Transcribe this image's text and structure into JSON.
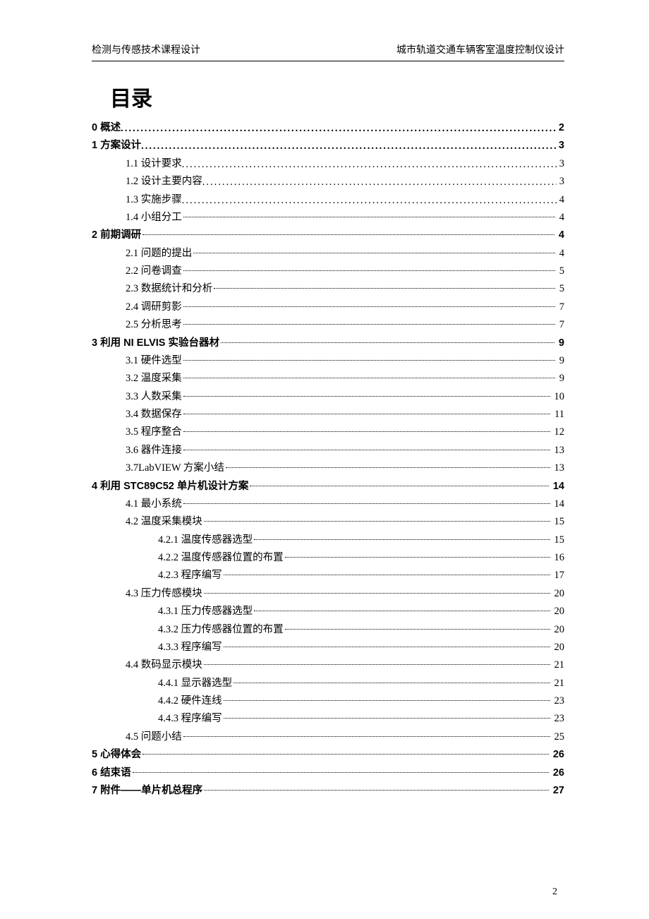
{
  "header": {
    "left": "检测与传感技术课程设计",
    "right": "城市轨道交通车辆客室温度控制仪设计"
  },
  "title": "目录",
  "page_number": "2",
  "toc": [
    {
      "level": 0,
      "label": "0 概述",
      "page": "2",
      "style": "dotted"
    },
    {
      "level": 0,
      "label": "1 方案设计",
      "page": "3",
      "style": "dotted"
    },
    {
      "level": 1,
      "label": "1.1 设计要求",
      "page": "3",
      "style": "dotted"
    },
    {
      "level": 1,
      "label": "1.2 设计主要内容",
      "page": "3",
      "style": "dotted"
    },
    {
      "level": 1,
      "label": "1.3 实施步骤",
      "page": "4",
      "style": "dotted"
    },
    {
      "level": 1,
      "label": "1.4 小组分工",
      "page": "4",
      "style": "dashed"
    },
    {
      "level": 0,
      "label": "2 前期调研",
      "page": "4",
      "style": "dashed"
    },
    {
      "level": 1,
      "label": "2.1 问题的提出",
      "page": "4",
      "style": "dashed"
    },
    {
      "level": 1,
      "label": "2.2 问卷调查",
      "page": "5",
      "style": "dashed"
    },
    {
      "level": 1,
      "label": "2.3 数据统计和分析",
      "page": "5",
      "style": "dashed"
    },
    {
      "level": 1,
      "label": "2.4 调研剪影",
      "page": "7",
      "style": "dashed"
    },
    {
      "level": 1,
      "label": "2.5 分析思考",
      "page": "7",
      "style": "dashed"
    },
    {
      "level": 0,
      "label": "3 利用 NI ELVIS 实验台器材",
      "page": "9",
      "style": "dashed"
    },
    {
      "level": 1,
      "label": "3.1 硬件选型",
      "page": "9",
      "style": "dashed"
    },
    {
      "level": 1,
      "label": "3.2 温度采集",
      "page": "9",
      "style": "dashed"
    },
    {
      "level": 1,
      "label": "3.3 人数采集",
      "page": "10",
      "style": "dashed"
    },
    {
      "level": 1,
      "label": "3.4 数据保存",
      "page": "11",
      "style": "dashed"
    },
    {
      "level": 1,
      "label": "3.5 程序整合",
      "page": "12",
      "style": "dashed"
    },
    {
      "level": 1,
      "label": "3.6 器件连接",
      "page": "13",
      "style": "dashed"
    },
    {
      "level": 1,
      "label": "3.7LabVIEW 方案小结",
      "page": "13",
      "style": "dashed"
    },
    {
      "level": 0,
      "label": "4 利用 STC89C52 单片机设计方案",
      "page": "14",
      "style": "dashed"
    },
    {
      "level": 1,
      "label": "4.1 最小系统",
      "page": "14",
      "style": "dashed"
    },
    {
      "level": 1,
      "label": "4.2 温度采集模块",
      "page": "15",
      "style": "dashed"
    },
    {
      "level": 2,
      "label": "4.2.1 温度传感器选型",
      "page": "15",
      "style": "dashed"
    },
    {
      "level": 2,
      "label": "4.2.2 温度传感器位置的布置",
      "page": "16",
      "style": "dashed"
    },
    {
      "level": 2,
      "label": "4.2.3 程序编写",
      "page": "17",
      "style": "dashed"
    },
    {
      "level": 1,
      "label": "4.3 压力传感模块",
      "page": "20",
      "style": "dashed"
    },
    {
      "level": 2,
      "label": "4.3.1 压力传感器选型",
      "page": "20",
      "style": "dashed"
    },
    {
      "level": 2,
      "label": "4.3.2 压力传感器位置的布置",
      "page": "20",
      "style": "dashed"
    },
    {
      "level": 2,
      "label": "4.3.3 程序编写",
      "page": "20",
      "style": "dashed"
    },
    {
      "level": 1,
      "label": "4.4 数码显示模块",
      "page": "21",
      "style": "dashed"
    },
    {
      "level": 2,
      "label": "4.4.1 显示器选型",
      "page": "21",
      "style": "dashed"
    },
    {
      "level": 2,
      "label": "4.4.2 硬件连线",
      "page": "23",
      "style": "dashed"
    },
    {
      "level": 2,
      "label": "4.4.3 程序编写",
      "page": "23",
      "style": "dashed"
    },
    {
      "level": 1,
      "label": "4.5 问题小结",
      "page": "25",
      "style": "dashed"
    },
    {
      "level": 0,
      "label": "5 心得体会",
      "page": "26",
      "style": "dashed"
    },
    {
      "level": 0,
      "label": "6 结束语",
      "page": "26",
      "style": "dashed"
    },
    {
      "level": 0,
      "label": "7 附件——单片机总程序",
      "page": "27",
      "style": "dashed"
    }
  ]
}
